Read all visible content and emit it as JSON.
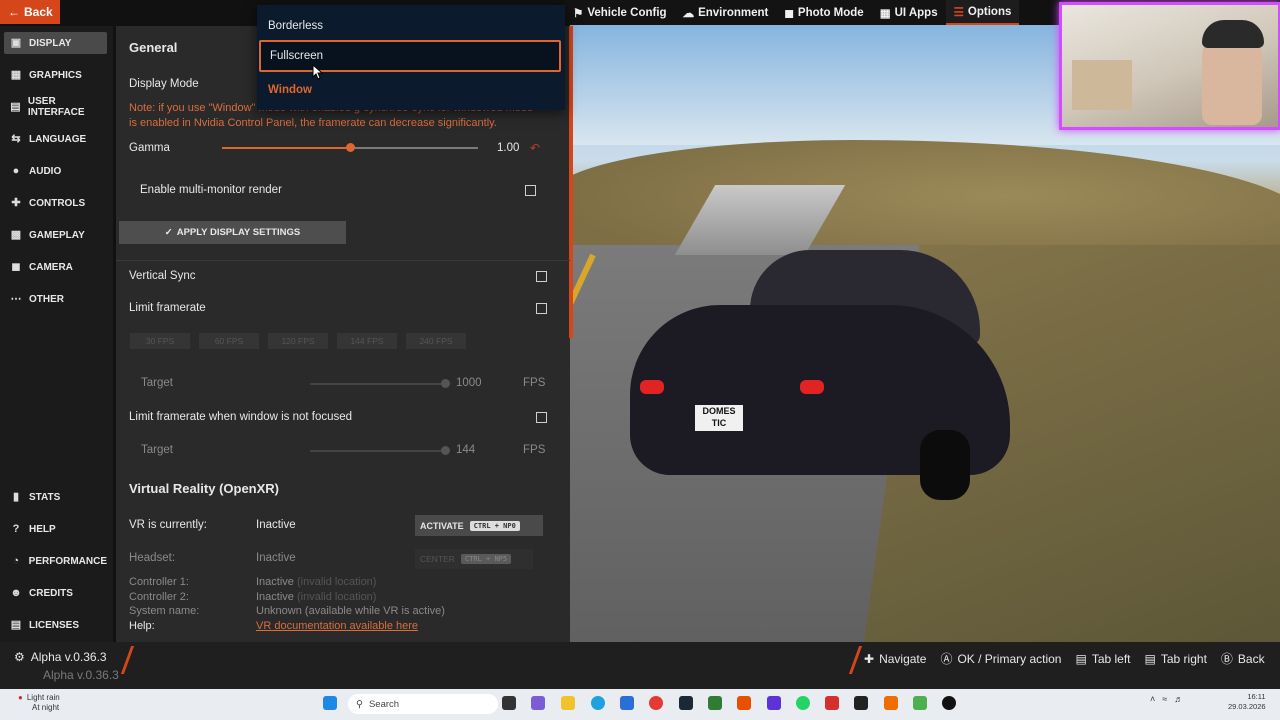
{
  "nav": {
    "back_label": "Back"
  },
  "sidebar": {
    "items": [
      {
        "label": "DISPLAY",
        "icon": "monitor-icon"
      },
      {
        "label": "GRAPHICS",
        "icon": "image-icon"
      },
      {
        "label": "USER INTERFACE",
        "icon": "window-icon"
      },
      {
        "label": "LANGUAGE",
        "icon": "translate-icon"
      },
      {
        "label": "AUDIO",
        "icon": "speaker-icon"
      },
      {
        "label": "CONTROLS",
        "icon": "gamepad-icon"
      },
      {
        "label": "GAMEPLAY",
        "icon": "puzzle-icon"
      },
      {
        "label": "CAMERA",
        "icon": "camera-icon"
      },
      {
        "label": "OTHER",
        "icon": "more-icon"
      }
    ],
    "bottom_items": [
      {
        "label": "STATS",
        "icon": "bar-chart-icon"
      },
      {
        "label": "HELP",
        "icon": "help-icon"
      },
      {
        "label": "PERFORMANCE",
        "icon": "gauge-icon"
      },
      {
        "label": "CREDITS",
        "icon": "people-icon"
      },
      {
        "label": "LICENSES",
        "icon": "document-icon"
      }
    ]
  },
  "general": {
    "title": "General",
    "display_mode_label": "Display Mode",
    "note_line1": "Note: if you use \"Window\"",
    "note_line1_tail": "mode with enabled g-sync/free-sync for windowed mode",
    "note_line2": "is enabled in Nvidia Control Panel, the framerate can decrease significantly.",
    "gamma_label": "Gamma",
    "gamma_value": "1.00",
    "gamma_fraction": 0.5,
    "multi_monitor_label": "Enable multi-monitor render",
    "apply_label": "APPLY DISPLAY SETTINGS",
    "vsync_label": "Vertical Sync",
    "limit_framerate_label": "Limit framerate",
    "fps_presets": [
      "30 FPS",
      "60 FPS",
      "120 FPS",
      "144 FPS",
      "240 FPS"
    ],
    "target_label": "Target",
    "target_value": "1000",
    "fps_unit": "FPS",
    "limit_unfocused_label": "Limit framerate when window is not focused",
    "target2_label": "Target",
    "target2_value": "144",
    "fps_unit2": "FPS"
  },
  "vr": {
    "title": "Virtual Reality (OpenXR)",
    "status_label": "VR is currently:",
    "status_value": "Inactive",
    "activate_label": "ACTIVATE",
    "activate_shortcut": "CTRL + NP0",
    "headset_label": "Headset:",
    "headset_value": "Inactive",
    "center_label": "CENTER",
    "center_shortcut": "CTRL + NP5",
    "controller1_label": "Controller 1:",
    "controller1_value": "Inactive",
    "controller1_note": "(invalid location)",
    "controller2_label": "Controller 2:",
    "controller2_value": "Inactive",
    "controller2_note": "(invalid location)",
    "system_label": "System name:",
    "system_value": "Unknown (available while VR is active)",
    "help_label": "Help:",
    "help_link": "VR documentation available here"
  },
  "dropdown": {
    "options": [
      "Borderless",
      "Fullscreen",
      "Window"
    ],
    "selected": "Fullscreen",
    "current": "Window"
  },
  "topmenu": [
    {
      "label": "Vehicle Config",
      "icon": "car-icon"
    },
    {
      "label": "Environment",
      "icon": "cloud-sun-icon"
    },
    {
      "label": "Photo Mode",
      "icon": "camera-icon"
    },
    {
      "label": "UI Apps",
      "icon": "apps-icon"
    },
    {
      "label": "Options",
      "icon": "sliders-icon"
    }
  ],
  "scene": {
    "plate_line1": "DOMES",
    "plate_line2": "TIC"
  },
  "bottombar": {
    "version": "Alpha v.0.36.3",
    "hints": [
      {
        "label": "Navigate",
        "icon": "dpad-icon"
      },
      {
        "label": "OK / Primary action",
        "icon": "a-button-icon"
      },
      {
        "label": "Tab left",
        "icon": "lb-button-icon"
      },
      {
        "label": "Tab right",
        "icon": "rb-button-icon"
      },
      {
        "label": "Back",
        "icon": "b-button-icon"
      }
    ]
  },
  "taskbar": {
    "weather_title": "Light rain",
    "weather_sub": "At night",
    "search_placeholder": "Search",
    "time": "16:11",
    "date": "29.03.2026"
  },
  "colors": {
    "accent": "#d5461b",
    "panel": "#2a2a2a",
    "sidebar": "#1b1b1b",
    "dropdown": "#0b1a2c"
  }
}
